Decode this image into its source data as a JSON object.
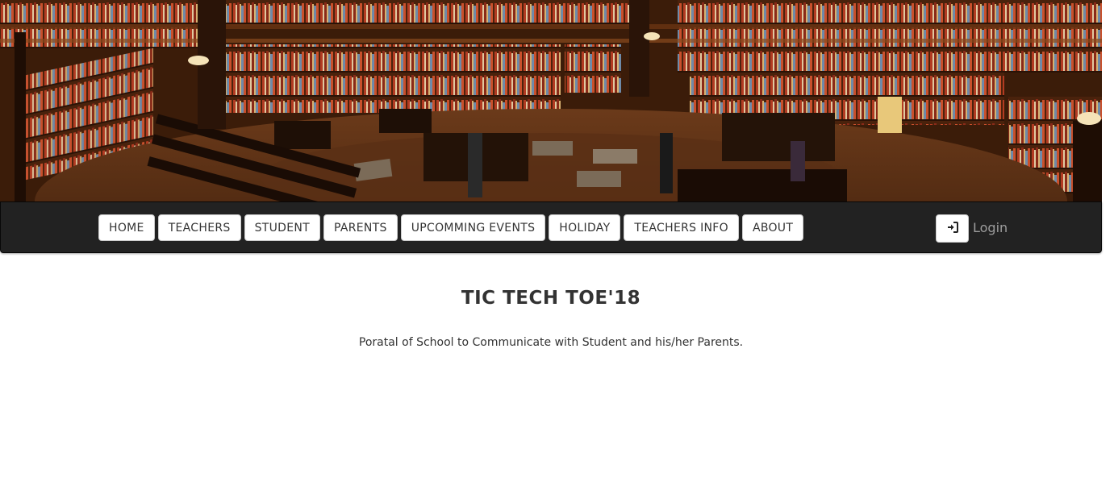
{
  "banner": {
    "image_description_icon": "library-banner-image"
  },
  "navbar": {
    "items": [
      {
        "label": "HOME"
      },
      {
        "label": "TEACHERS"
      },
      {
        "label": "STUDENT"
      },
      {
        "label": "PARENTS"
      },
      {
        "label": "UPCOMMING EVENTS"
      },
      {
        "label": "HOLIDAY"
      },
      {
        "label": "TEACHERS INFO"
      },
      {
        "label": "ABOUT"
      }
    ],
    "login": {
      "icon": "sign-in-icon",
      "label": "Login"
    }
  },
  "main": {
    "title": "TIC TECH TOE'18",
    "subtitle": "Poratal of School to Communicate with Student and his/her Parents."
  },
  "colors": {
    "navbar_bg": "#222222",
    "nav_button_bg": "#ffffff",
    "login_text": "#9d9d9d",
    "text": "#333333"
  }
}
